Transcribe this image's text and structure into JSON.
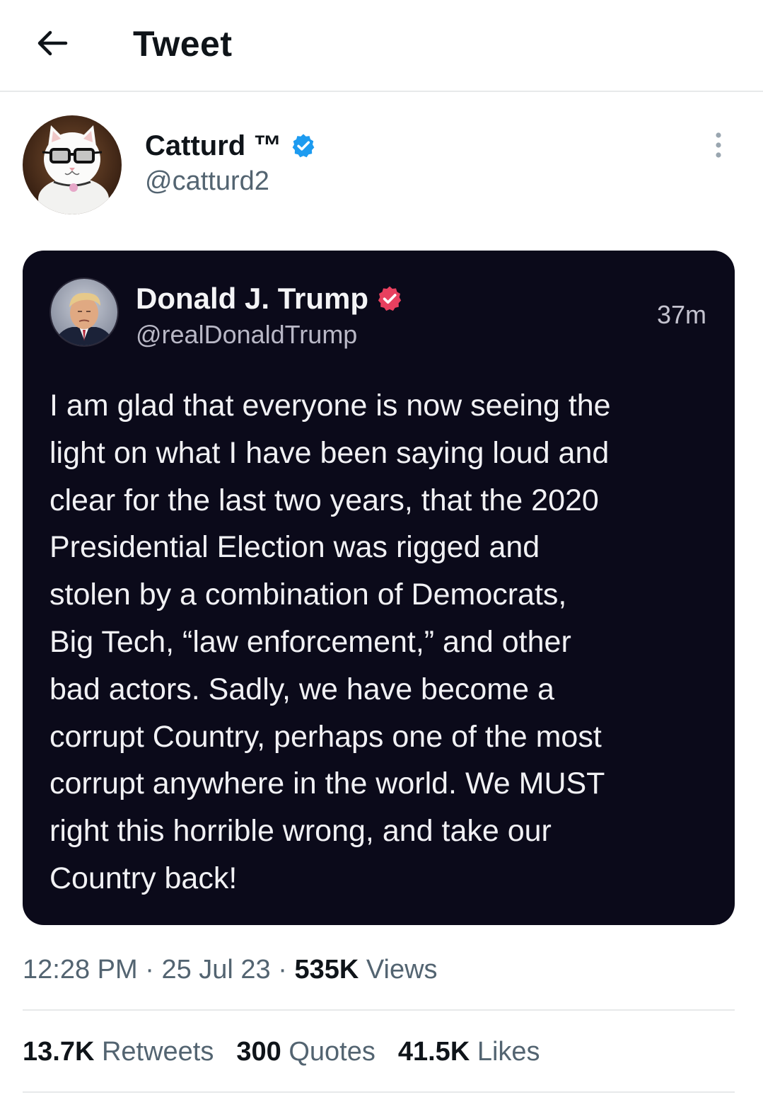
{
  "header": {
    "title": "Tweet",
    "back_icon": "arrow-left-icon"
  },
  "author": {
    "display_name": "Catturd ™",
    "handle": "@catturd2",
    "verified": true,
    "badge_color": "#1d9bf0",
    "more_icon": "more-vertical-icon"
  },
  "embedded_post": {
    "display_name": "Donald J. Trump",
    "handle": "@realDonaldTrump",
    "time": "37m",
    "badge_color": "#e8405f",
    "background": "#0b0a1a",
    "lines": [
      "I am glad that everyone is now seeing the",
      "light on what I have been saying loud and",
      "clear for the last two years, that the 2020",
      "Presidential Election was rigged and",
      "stolen by a combination of Democrats,",
      "Big Tech, “law enforcement,” and other",
      "bad actors. Sadly, we have become a",
      "corrupt Country, perhaps one of the most",
      "corrupt anywhere in the world. We MUST",
      "right this horrible wrong, and take our",
      "Country back!"
    ]
  },
  "meta": {
    "time": "12:28 PM",
    "sep1": " · ",
    "date": "25 Jul 23",
    "sep2": " · ",
    "views_count": "535K",
    "views_label": " Views"
  },
  "stats": {
    "retweets_count": "13.7K",
    "retweets_label": " Retweets",
    "quotes_count": "300",
    "quotes_label": " Quotes",
    "likes_count": "41.5K",
    "likes_label": " Likes"
  },
  "colors": {
    "text_primary": "#0f1419",
    "text_secondary": "#536471",
    "divider": "#e7e9ea"
  }
}
